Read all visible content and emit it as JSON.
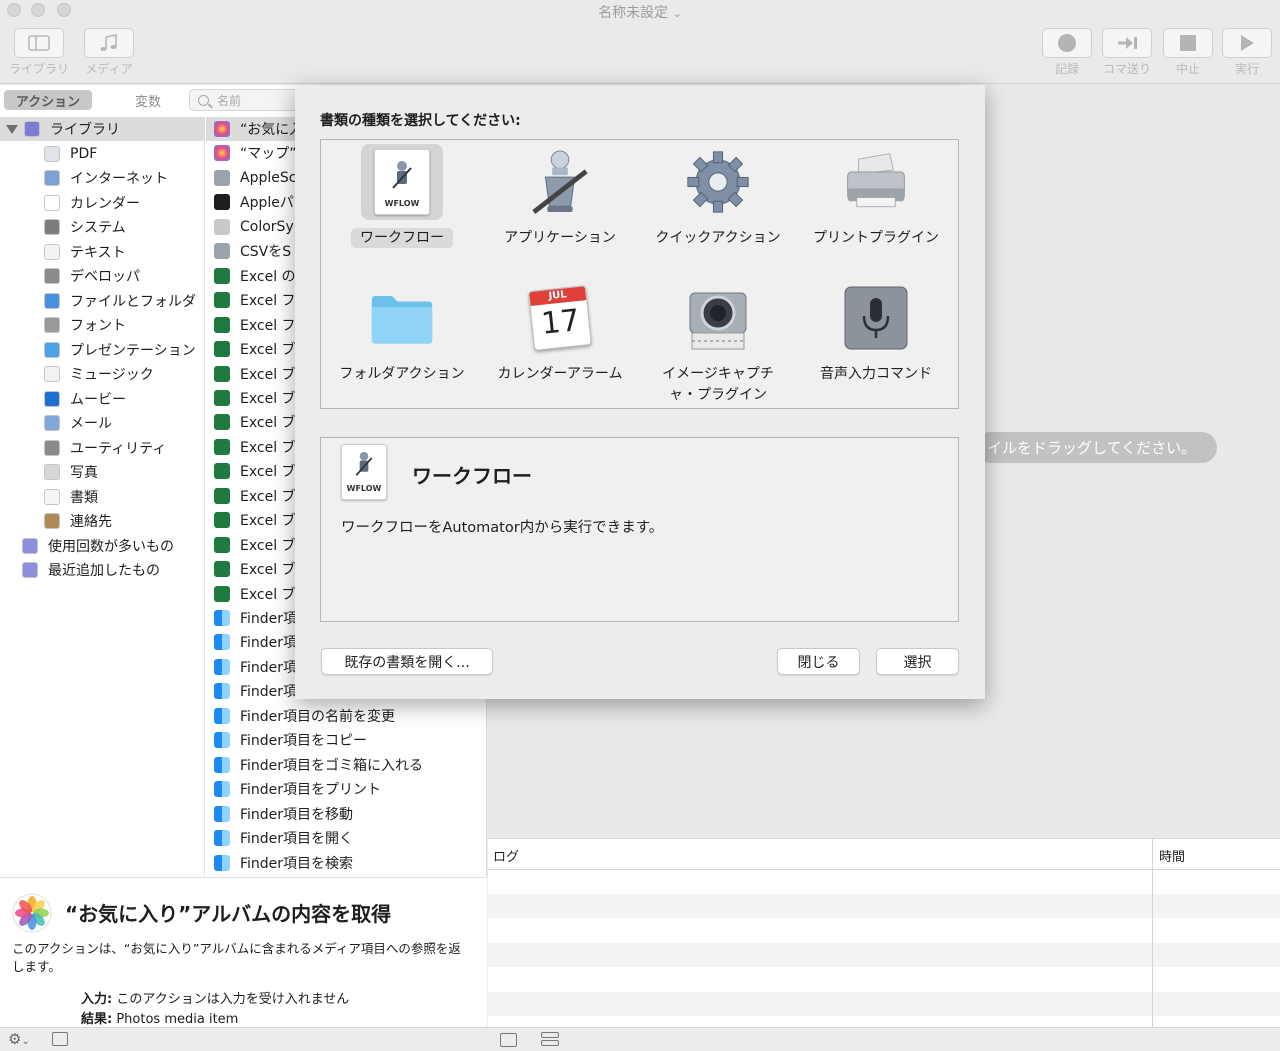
{
  "window": {
    "title": "名称未設定"
  },
  "toolbar": {
    "library": "ライブラリ",
    "media": "メディア",
    "record": "記録",
    "step": "コマ送り",
    "stop": "中止",
    "run": "実行"
  },
  "left": {
    "tabs": {
      "actions": "アクション",
      "variables": "変数"
    },
    "search_placeholder": "名前",
    "library": [
      "ライブラリ",
      "PDF",
      "インターネット",
      "カレンダー",
      "システム",
      "テキスト",
      "デベロッパ",
      "ファイルとフォルダ",
      "フォント",
      "プレゼンテーション",
      "ミュージック",
      "ムービー",
      "メール",
      "ユーティリティ",
      "写真",
      "書類",
      "連絡先",
      "使用回数が多いもの",
      "最近追加したもの"
    ],
    "actions": [
      "“お気に入",
      "“マップ”で",
      "AppleSc",
      "Appleパ",
      "ColorSyn",
      "CSVをS",
      "Excel の",
      "Excel フ",
      "Excel フ",
      "Excel ブ",
      "Excel ブ",
      "Excel ブ",
      "Excel ブ",
      "Excel ブ",
      "Excel ブ",
      "Excel ブ",
      "Excel ブ",
      "Excel ブ",
      "Excel ブ",
      "Excel ブ",
      "Finder項",
      "Finder項",
      "Finder項",
      "Finder項",
      "Finder項目の名前を変更",
      "Finder項目をコピー",
      "Finder項目をゴミ箱に入れる",
      "Finder項目をプリント",
      "Finder項目を移動",
      "Finder項目を開く",
      "Finder項目を検索"
    ],
    "description": {
      "title": "“お気に入り”アルバムの内容を取得",
      "text": "このアクションは、“お気に入り”アルバムに含まれるメディア項目への参照を返します。",
      "input_key": "入力:",
      "input_value": "このアクションは入力を受け入れません",
      "result_key": "結果:",
      "result_value": "Photos media item"
    }
  },
  "workflow": {
    "drag_hint": "イルをドラッグしてください。"
  },
  "log": {
    "col_log": "ログ",
    "col_time": "時間"
  },
  "sheet": {
    "title": "書類の種類を選択してください:",
    "types": [
      {
        "label": "ワークフロー",
        "icon": "workflow-icon"
      },
      {
        "label": "アプリケーション",
        "icon": "application-icon"
      },
      {
        "label": "クイックアクション",
        "icon": "gear-icon"
      },
      {
        "label": "プリントプラグイン",
        "icon": "printer-icon"
      },
      {
        "label": "フォルダアクション",
        "icon": "folder-icon"
      },
      {
        "label": "カレンダーアラーム",
        "icon": "calendar-icon"
      },
      {
        "label": "イメージキャプチャ・プラグイン",
        "label_line1": "イメージキャプチ",
        "label_line2": "ャ・プラグイン",
        "icon": "camera-icon"
      },
      {
        "label": "音声入力コマンド",
        "icon": "microphone-icon"
      }
    ],
    "selected": {
      "title": "ワークフロー",
      "description": "ワークフローをAutomator内から実行できます。",
      "doc_tag": "WFLOW"
    },
    "calendar": {
      "month": "JUL",
      "day": "17"
    },
    "buttons": {
      "open": "既存の書類を開く...",
      "close": "閉じる",
      "choose": "選択"
    }
  }
}
